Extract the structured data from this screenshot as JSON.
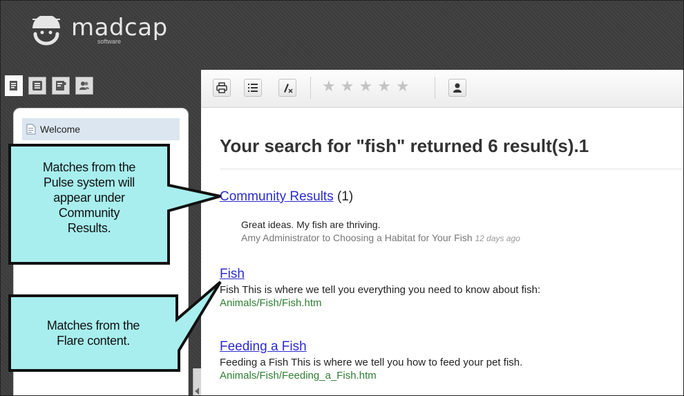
{
  "brand": {
    "name": "madcap",
    "sub": "software"
  },
  "nav": {
    "tabs": [
      {
        "icon": "document-icon",
        "active": true
      },
      {
        "icon": "list-icon",
        "active": false
      },
      {
        "icon": "index-icon",
        "active": false
      },
      {
        "icon": "community-icon",
        "active": false
      }
    ],
    "toc_item": "Welcome"
  },
  "toolbar": {
    "icons": [
      "print-icon",
      "list-icon",
      "clear-highlight-icon",
      "user-icon"
    ],
    "star_rating": {
      "filled": 0,
      "max": 5,
      "glyph": "★"
    }
  },
  "search": {
    "heading": "Your search for \"fish\" returned 6 result(s).1",
    "community": {
      "link_text": "Community Results",
      "count": "(1)",
      "comment": "Great ideas. My fish are thriving.",
      "meta": "Amy Administrator to Choosing a Habitat for Your Fish",
      "time": "12 days ago"
    },
    "results": [
      {
        "title": "Fish",
        "desc": "Fish This is where we tell you everything you need to know about fish:",
        "path": "Animals/Fish/Fish.htm"
      },
      {
        "title": "Feeding a Fish",
        "desc": "Feeding a Fish This is where we tell you how to feed your pet fish.",
        "path": "Animals/Fish/Feeding_a_Fish.htm"
      }
    ]
  },
  "callouts": [
    {
      "lines": [
        "Matches from the",
        "Pulse system will",
        "appear under",
        "Community",
        "Results."
      ]
    },
    {
      "lines": [
        "Matches from the",
        "Flare content."
      ]
    }
  ],
  "colors": {
    "callout_fill": "#a8eeee",
    "link": "#2b2bd1",
    "path": "#2e7d32"
  }
}
